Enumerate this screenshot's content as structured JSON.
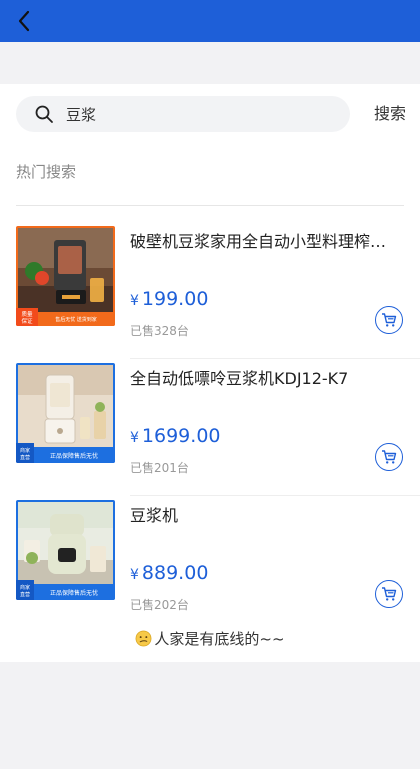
{
  "nav": {
    "back_icon": "chevron-left-icon"
  },
  "search": {
    "query": "豆浆",
    "button_label": "搜索",
    "icon": "search-icon"
  },
  "hot": {
    "label": "热门搜索"
  },
  "products": [
    {
      "name": "破壁机豆浆家用全自动小型料理榨…",
      "currency": "¥",
      "price": "199.00",
      "sold": "已售328台",
      "thumb_badge_left": "质量\n保证",
      "thumb_badge_right": "售后无忧  送货到家"
    },
    {
      "name": "全自动低嘌呤豆浆机KDJ12-K7",
      "currency": "¥",
      "price": "1699.00",
      "sold": "已售201台",
      "thumb_badge_left": "商家\n直营",
      "thumb_badge_right": "正品保障售后无忧"
    },
    {
      "name": "豆浆机",
      "currency": "¥",
      "price": "889.00",
      "sold": "已售202台",
      "thumb_badge_left": "商家\n直营",
      "thumb_badge_right": "正品保障售后无忧"
    }
  ],
  "footer": {
    "text": "人家是有底线的~~"
  },
  "colors": {
    "brand": "#1e5fd8",
    "background": "#f2f2f4"
  }
}
